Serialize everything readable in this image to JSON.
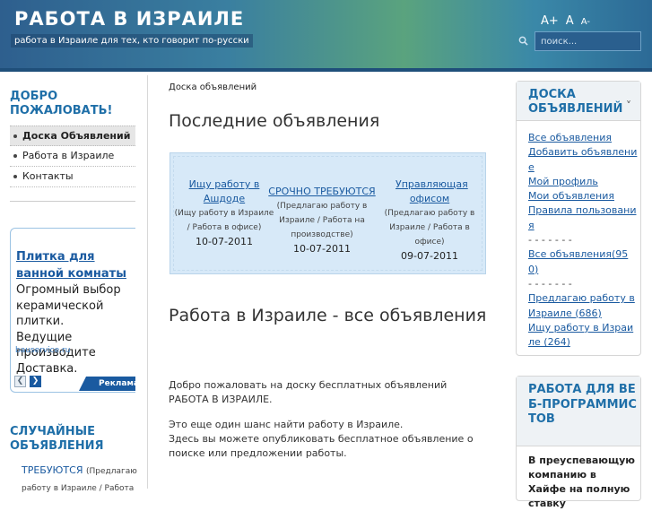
{
  "header": {
    "title": "РАБОТА В ИЗРАИЛЕ",
    "tagline": "работа в Израиле для тех, кто говорит по-русски",
    "font_controls": [
      "A+",
      "A",
      "A-"
    ],
    "search_placeholder": "поиск..."
  },
  "sidebar": {
    "welcome_title": "ДОБРО ПОЖАЛОВАТЬ!",
    "nav": [
      "Доска Объявлений",
      "Работа в Израиле",
      "Контакты"
    ],
    "ad": {
      "title": "Плитка для ванной комнаты",
      "text": "Огромный выбор\nкерамической плитки.\nВедущие производите\nДоставка.",
      "domain": "bauservice.ru",
      "label": "Реклама от"
    },
    "random_title": "СЛУЧАЙНЫЕ ОБЪЯВЛЕНИЯ",
    "random_item": {
      "link": "ТРЕБУЮТСЯ",
      "sub": "(Предлагаю",
      "sub2": "работу в Израиле / Работа"
    }
  },
  "main": {
    "breadcrumb": "Доска объявлений",
    "latest_title": "Последние объявления",
    "ads": [
      {
        "title": "Ищу работу в Ашдоде",
        "sub": "(Ищу работу в Израиле / Работа в офисе)",
        "date": "10-07-2011"
      },
      {
        "title": "СРОЧНО ТРЕБУЮТСЯ",
        "sub": "(Предлагаю работу в Израиле / Работа на производстве)",
        "date": "10-07-2011"
      },
      {
        "title": "Управляющая офисом",
        "sub": "(Предлагаю работу в Израиле / Работа в офисе)",
        "date": "09-07-2011"
      }
    ],
    "section_title": "Работа в Израиле - все объявления",
    "intro1": "Добро пожаловать на доску бесплатных объявлений РАБОТА В ИЗРАИЛЕ.",
    "intro2a": "Это еще один шанс найти работу в Израиле.",
    "intro2b": "Здесь вы можете опубликовать бесплатное объявление о поиске или предложении работы."
  },
  "right": {
    "board_title": "ДОСКА ОБЪЯВЛЕНИЙ",
    "collapse": "˅",
    "links": [
      "Все объявления",
      "Добавить объявление",
      "Мой профиль",
      "Мои объявления",
      "Правила пользования"
    ],
    "dash": "- - - - - - -",
    "all_count": "Все объявления(950)",
    "cat1": "Предлагаю работу в Израиле (686)",
    "cat2": "Ищу работу в Израиле (264)",
    "webdev_title": "РАБОТА ДЛЯ ВЕБ-ПРОГРАММИСТОВ",
    "webdev_text": "В преуспевающую компанию в Хайфе на полную ставку"
  }
}
